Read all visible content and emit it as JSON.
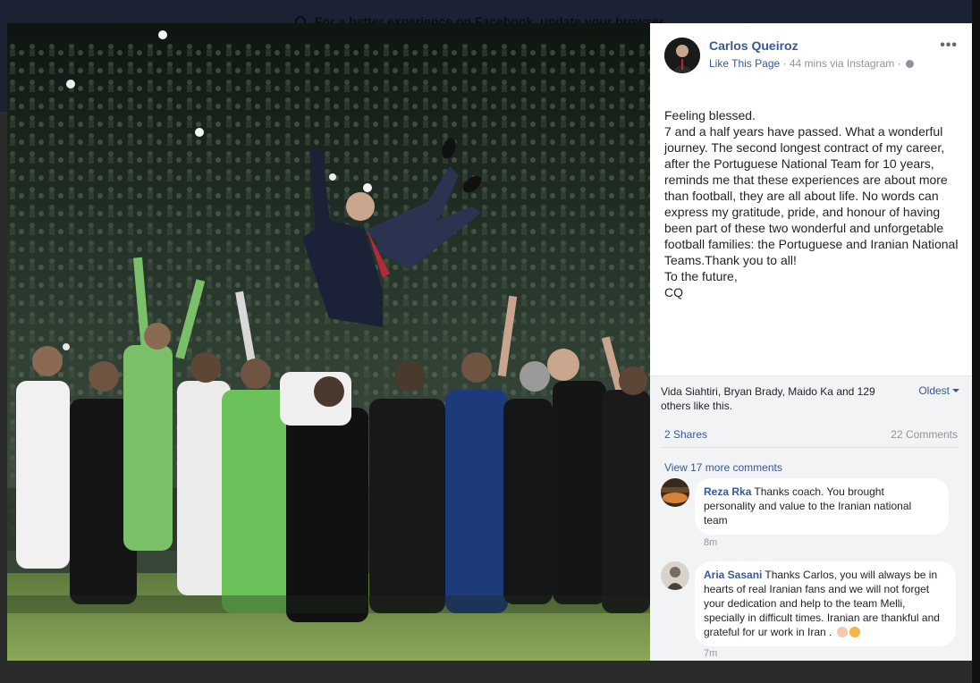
{
  "browser_banner": {
    "text": "For a better experience on Facebook, update your browser."
  },
  "post": {
    "author": "Carlos Queiroz",
    "like_page_label": "Like This Page",
    "timestamp": "44 mins via Instagram",
    "separator": "·",
    "body_lines": [
      "Feeling blessed.",
      "7 and a half years have passed. What a wonderful journey. The second longest contract of my career, after the Portuguese National Team for 10 years, reminds me that these experiences are about more than football, they are all about life. No words can express my gratitude, pride, and honour of having been part of these two wonderful and unforgetable football families: the Portuguese and Iranian National Teams.Thank you to all!",
      "To the future,",
      "CQ"
    ]
  },
  "feedback": {
    "likes_text": "Vida Siahtiri, Bryan Brady, Maido Ka and 129 others like this.",
    "sort_label": "Oldest",
    "shares": "2 Shares",
    "comments_count": "22 Comments",
    "view_more": "View 17 more comments"
  },
  "comments": [
    {
      "name": "Reza Rka",
      "text": "Thanks coach. You brought personality and value to the Iranian national team",
      "time": "8m"
    },
    {
      "name": "Aria Sasani",
      "text": "Thanks Carlos, you will always be in hearts of real Iranian fans and we will not forget your dedication and help to the team Melli, specially in difficult times. Iranian are thankful and grateful for ur work in Iran .",
      "time": "7m"
    }
  ],
  "colors": {
    "link": "#365899",
    "muted": "#90949c",
    "panel_bg": "#f2f3f5"
  },
  "icons": [
    "globe-icon",
    "more-options-icon",
    "dropdown-caret-icon",
    "info-icon",
    "clapping-hands-emoji",
    "praying-hands-emoji"
  ]
}
